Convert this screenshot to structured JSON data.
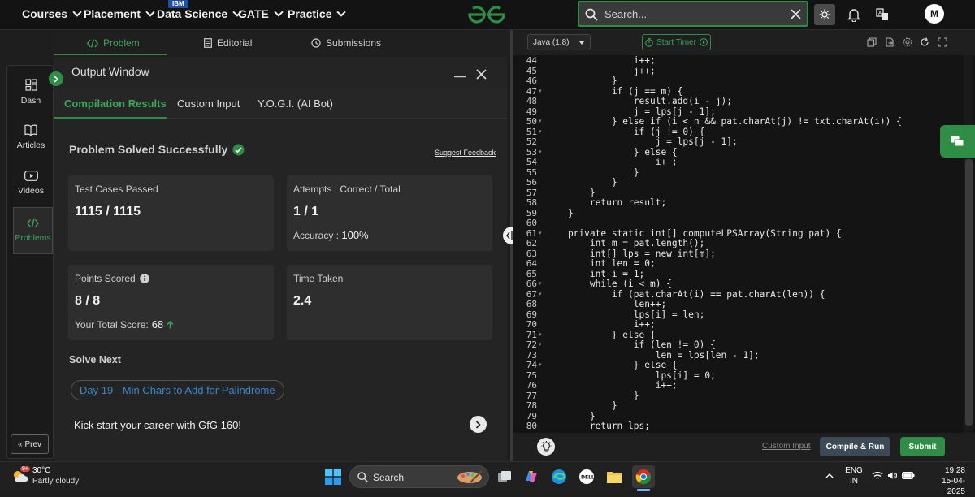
{
  "nav": {
    "items": [
      "Courses",
      "Placement",
      "Data Science",
      "GATE",
      "Practice"
    ],
    "ibm_badge": "IBM",
    "search_placeholder": "Search...",
    "avatar_letter": "M"
  },
  "problem_tabs": [
    "Problem",
    "Editorial",
    "Submissions"
  ],
  "sidebar": {
    "items": [
      "Dash",
      "Articles",
      "Videos",
      "Problems"
    ],
    "prev": "Prev"
  },
  "output": {
    "title": "Output Window",
    "tabs": [
      "Compilation Results",
      "Custom Input",
      "Y.O.G.I. (AI Bot)"
    ],
    "status": "Problem Solved Successfully",
    "feedback": "Suggest Feedback",
    "test_cases_label": "Test Cases Passed",
    "test_cases_value": "1115 / 1115",
    "attempts_label": "Attempts : Correct / Total",
    "attempts_value": "1 / 1",
    "accuracy_label": "Accuracy :",
    "accuracy_value": "100%",
    "points_label": "Points Scored",
    "points_value": "8 / 8",
    "total_score_label": "Your Total Score:",
    "total_score_value": "68",
    "time_label": "Time Taken",
    "time_value": "2.4",
    "solve_next_label": "Solve Next",
    "next_problem": "Day 19 - Min Chars to Add for Palindrome",
    "kickstart": "Kick start your career with GfG 160!"
  },
  "editor": {
    "language": "Java (1.8)",
    "timer_label": "Start Timer",
    "lines": [
      {
        "n": "44",
        "code": "                i++;"
      },
      {
        "n": "45",
        "code": "                j++;"
      },
      {
        "n": "46",
        "code": "            }"
      },
      {
        "n": "47",
        "code": "            if (j == m) {"
      },
      {
        "n": "48",
        "code": "                result.add(i - j);"
      },
      {
        "n": "49",
        "code": "                j = lps[j - 1];"
      },
      {
        "n": "50",
        "code": "            } else if (i < n && pat.charAt(j) != txt.charAt(i)) {"
      },
      {
        "n": "51",
        "code": "                if (j != 0) {"
      },
      {
        "n": "52",
        "code": "                    j = lps[j - 1];"
      },
      {
        "n": "53",
        "code": "                } else {"
      },
      {
        "n": "54",
        "code": "                    i++;"
      },
      {
        "n": "55",
        "code": "                }"
      },
      {
        "n": "56",
        "code": "            }"
      },
      {
        "n": "57",
        "code": "        }"
      },
      {
        "n": "58",
        "code": "        return result;"
      },
      {
        "n": "59",
        "code": "    }"
      },
      {
        "n": "60",
        "code": ""
      },
      {
        "n": "61",
        "code": "    private static int[] computeLPSArray(String pat) {"
      },
      {
        "n": "62",
        "code": "        int m = pat.length();"
      },
      {
        "n": "63",
        "code": "        int[] lps = new int[m];"
      },
      {
        "n": "64",
        "code": "        int len = 0;"
      },
      {
        "n": "65",
        "code": "        int i = 1;"
      },
      {
        "n": "66",
        "code": "        while (i < m) {"
      },
      {
        "n": "67",
        "code": "            if (pat.charAt(i) == pat.charAt(len)) {"
      },
      {
        "n": "68",
        "code": "                len++;"
      },
      {
        "n": "69",
        "code": "                lps[i] = len;"
      },
      {
        "n": "70",
        "code": "                i++;"
      },
      {
        "n": "71",
        "code": "            } else {"
      },
      {
        "n": "72",
        "code": "                if (len != 0) {"
      },
      {
        "n": "73",
        "code": "                    len = lps[len - 1];"
      },
      {
        "n": "74",
        "code": "                } else {"
      },
      {
        "n": "75",
        "code": "                    lps[i] = 0;"
      },
      {
        "n": "76",
        "code": "                    i++;"
      },
      {
        "n": "77",
        "code": "                }"
      },
      {
        "n": "78",
        "code": "            }"
      },
      {
        "n": "79",
        "code": "        }"
      },
      {
        "n": "80",
        "code": "        return lps;"
      }
    ],
    "foldable": [
      "47",
      "50",
      "51",
      "53",
      "61",
      "66",
      "67",
      "71",
      "72",
      "74"
    ],
    "custom_input": "Custom Input",
    "compile": "Compile & Run",
    "submit": "Submit"
  },
  "taskbar": {
    "temp": "30°C",
    "condition": "Partly cloudy",
    "weather_badge": "9+",
    "search_placeholder": "Search",
    "lang1": "ENG",
    "lang2": "IN",
    "time": "19:28",
    "date": "15-04-2025"
  },
  "colors": {
    "accent": "#2f8d46",
    "link": "#3b86c9",
    "background": "#1e1e1e"
  }
}
